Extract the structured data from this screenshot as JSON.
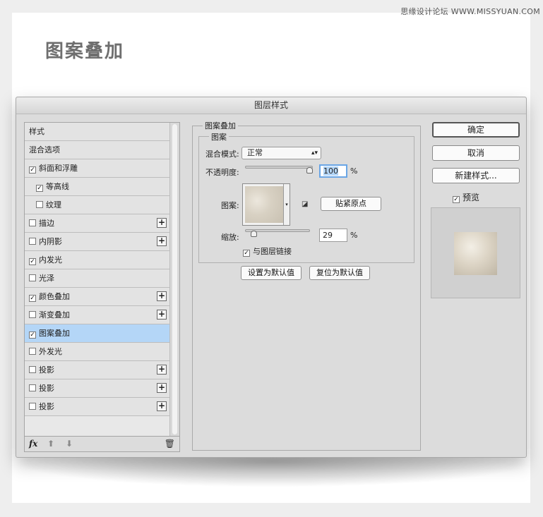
{
  "watermark": "思缘设计论坛 WWW.MISSYUAN.COM",
  "page_title": "图案叠加",
  "dialog": {
    "title": "图层样式",
    "styles_list": [
      {
        "label": "样式",
        "checkbox": false,
        "checked": false,
        "plus": false,
        "selected": false,
        "indent": false
      },
      {
        "label": "混合选项",
        "checkbox": false,
        "checked": false,
        "plus": false,
        "selected": false,
        "indent": false
      },
      {
        "label": "斜面和浮雕",
        "checkbox": true,
        "checked": true,
        "plus": false,
        "selected": false,
        "indent": false
      },
      {
        "label": "等高线",
        "checkbox": true,
        "checked": true,
        "plus": false,
        "selected": false,
        "indent": true
      },
      {
        "label": "纹理",
        "checkbox": true,
        "checked": false,
        "plus": false,
        "selected": false,
        "indent": true
      },
      {
        "label": "描边",
        "checkbox": true,
        "checked": false,
        "plus": true,
        "selected": false,
        "indent": false
      },
      {
        "label": "内阴影",
        "checkbox": true,
        "checked": false,
        "plus": true,
        "selected": false,
        "indent": false
      },
      {
        "label": "内发光",
        "checkbox": true,
        "checked": true,
        "plus": false,
        "selected": false,
        "indent": false
      },
      {
        "label": "光泽",
        "checkbox": true,
        "checked": false,
        "plus": false,
        "selected": false,
        "indent": false
      },
      {
        "label": "颜色叠加",
        "checkbox": true,
        "checked": true,
        "plus": true,
        "selected": false,
        "indent": false
      },
      {
        "label": "渐变叠加",
        "checkbox": true,
        "checked": false,
        "plus": true,
        "selected": false,
        "indent": false
      },
      {
        "label": "图案叠加",
        "checkbox": true,
        "checked": true,
        "plus": false,
        "selected": true,
        "indent": false
      },
      {
        "label": "外发光",
        "checkbox": true,
        "checked": false,
        "plus": false,
        "selected": false,
        "indent": false
      },
      {
        "label": "投影",
        "checkbox": true,
        "checked": false,
        "plus": true,
        "selected": false,
        "indent": false
      },
      {
        "label": "投影",
        "checkbox": true,
        "checked": false,
        "plus": true,
        "selected": false,
        "indent": false
      },
      {
        "label": "投影",
        "checkbox": true,
        "checked": false,
        "plus": true,
        "selected": false,
        "indent": false
      }
    ],
    "footer": {
      "fx": "fx",
      "up_icon": "arrow-up-icon",
      "down_icon": "arrow-down-icon",
      "trash_icon": "trash-icon"
    },
    "settings": {
      "group_title": "图案叠加",
      "inner_title": "图案",
      "blend_mode_label": "混合模式:",
      "blend_mode_value": "正常",
      "opacity_label": "不透明度:",
      "opacity_value": "100",
      "opacity_fraction": 1.0,
      "pattern_label": "图案:",
      "snap_button": "贴紧原点",
      "scale_label": "缩放:",
      "scale_value": "29",
      "scale_fraction": 0.1,
      "percent": "%",
      "link_label": "与图层链接",
      "link_checked": true,
      "make_default": "设置为默认值",
      "reset_default": "复位为默认值"
    },
    "right": {
      "ok": "确定",
      "cancel": "取消",
      "new_style": "新建样式...",
      "preview_label": "预览",
      "preview_checked": true
    }
  },
  "colors": {
    "selected_row": "#b4d6f7",
    "dialog_bg": "#dcdcdc",
    "focus_ring": "#6aa6e6"
  }
}
